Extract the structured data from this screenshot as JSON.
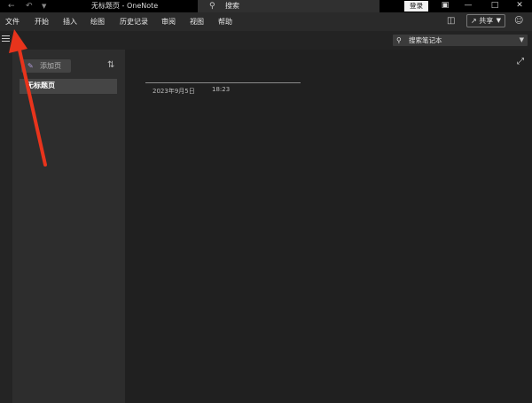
{
  "titlebar": {
    "doc_title": "无标题页 - OneNote",
    "search_label": "搜索",
    "signin_label": "登录"
  },
  "menu": {
    "items": [
      "文件",
      "开始",
      "插入",
      "绘图",
      "历史记录",
      "审阅",
      "视图",
      "帮助"
    ],
    "share_label": "共享"
  },
  "navbar": {
    "search_placeholder": "搜索笔记本"
  },
  "pages": {
    "add_page_label": "添加页",
    "items": [
      {
        "label": "无标题页"
      }
    ]
  },
  "page": {
    "date": "2023年9月5日",
    "time": "18:23"
  },
  "icons": {
    "back": "back-arrow-icon",
    "undo": "undo-icon",
    "quick_access": "quick-access-dropdown-icon",
    "search": "search-icon",
    "ribbon_display": "ribbon-display-icon",
    "minimize": "minimize-icon",
    "maximize": "maximize-icon",
    "close": "close-icon",
    "sticky_notes": "sticky-notes-icon",
    "share": "share-icon",
    "feedback": "feedback-icon",
    "hamburger": "hamburger-menu-icon",
    "sort": "sort-icon",
    "expand": "expand-icon"
  },
  "colors": {
    "annotation_arrow": "#e8341c",
    "add_page_icon": "#b39ddb"
  }
}
